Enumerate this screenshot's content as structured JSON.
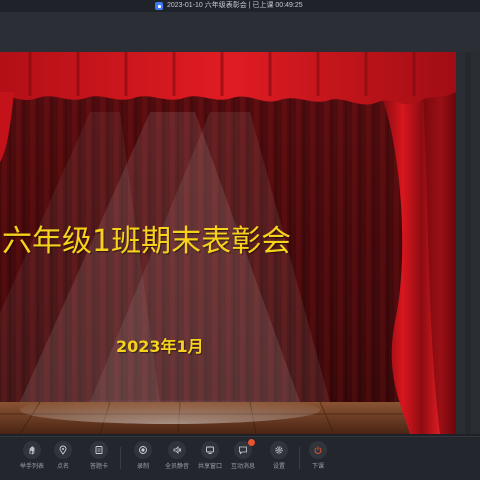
{
  "window": {
    "title": "2023-01-10 六年级表彰会 | 已上课 00:49:25"
  },
  "slide": {
    "title": "六年级1班期末表彰会",
    "date": "2023年1月",
    "colors": {
      "curtain": "#c4121a",
      "text": "#f6d21a",
      "floor": "#6b3a22"
    }
  },
  "toolbar": {
    "items": [
      {
        "id": "hand",
        "label": "举手列表",
        "icon": "hand-icon"
      },
      {
        "id": "roll",
        "label": "点名",
        "icon": "location-pin-icon"
      },
      {
        "id": "card",
        "label": "答题卡",
        "icon": "card-icon"
      },
      {
        "id": "record",
        "label": "录制",
        "icon": "record-icon"
      },
      {
        "id": "mute",
        "label": "全员静音",
        "icon": "mute-icon"
      },
      {
        "id": "share",
        "label": "共享窗口",
        "icon": "screen-share-icon"
      },
      {
        "id": "chat",
        "label": "互动消息",
        "icon": "chat-icon"
      },
      {
        "id": "settings",
        "label": "设置",
        "icon": "gear-icon"
      },
      {
        "id": "end",
        "label": "下课",
        "icon": "power-icon"
      }
    ]
  }
}
